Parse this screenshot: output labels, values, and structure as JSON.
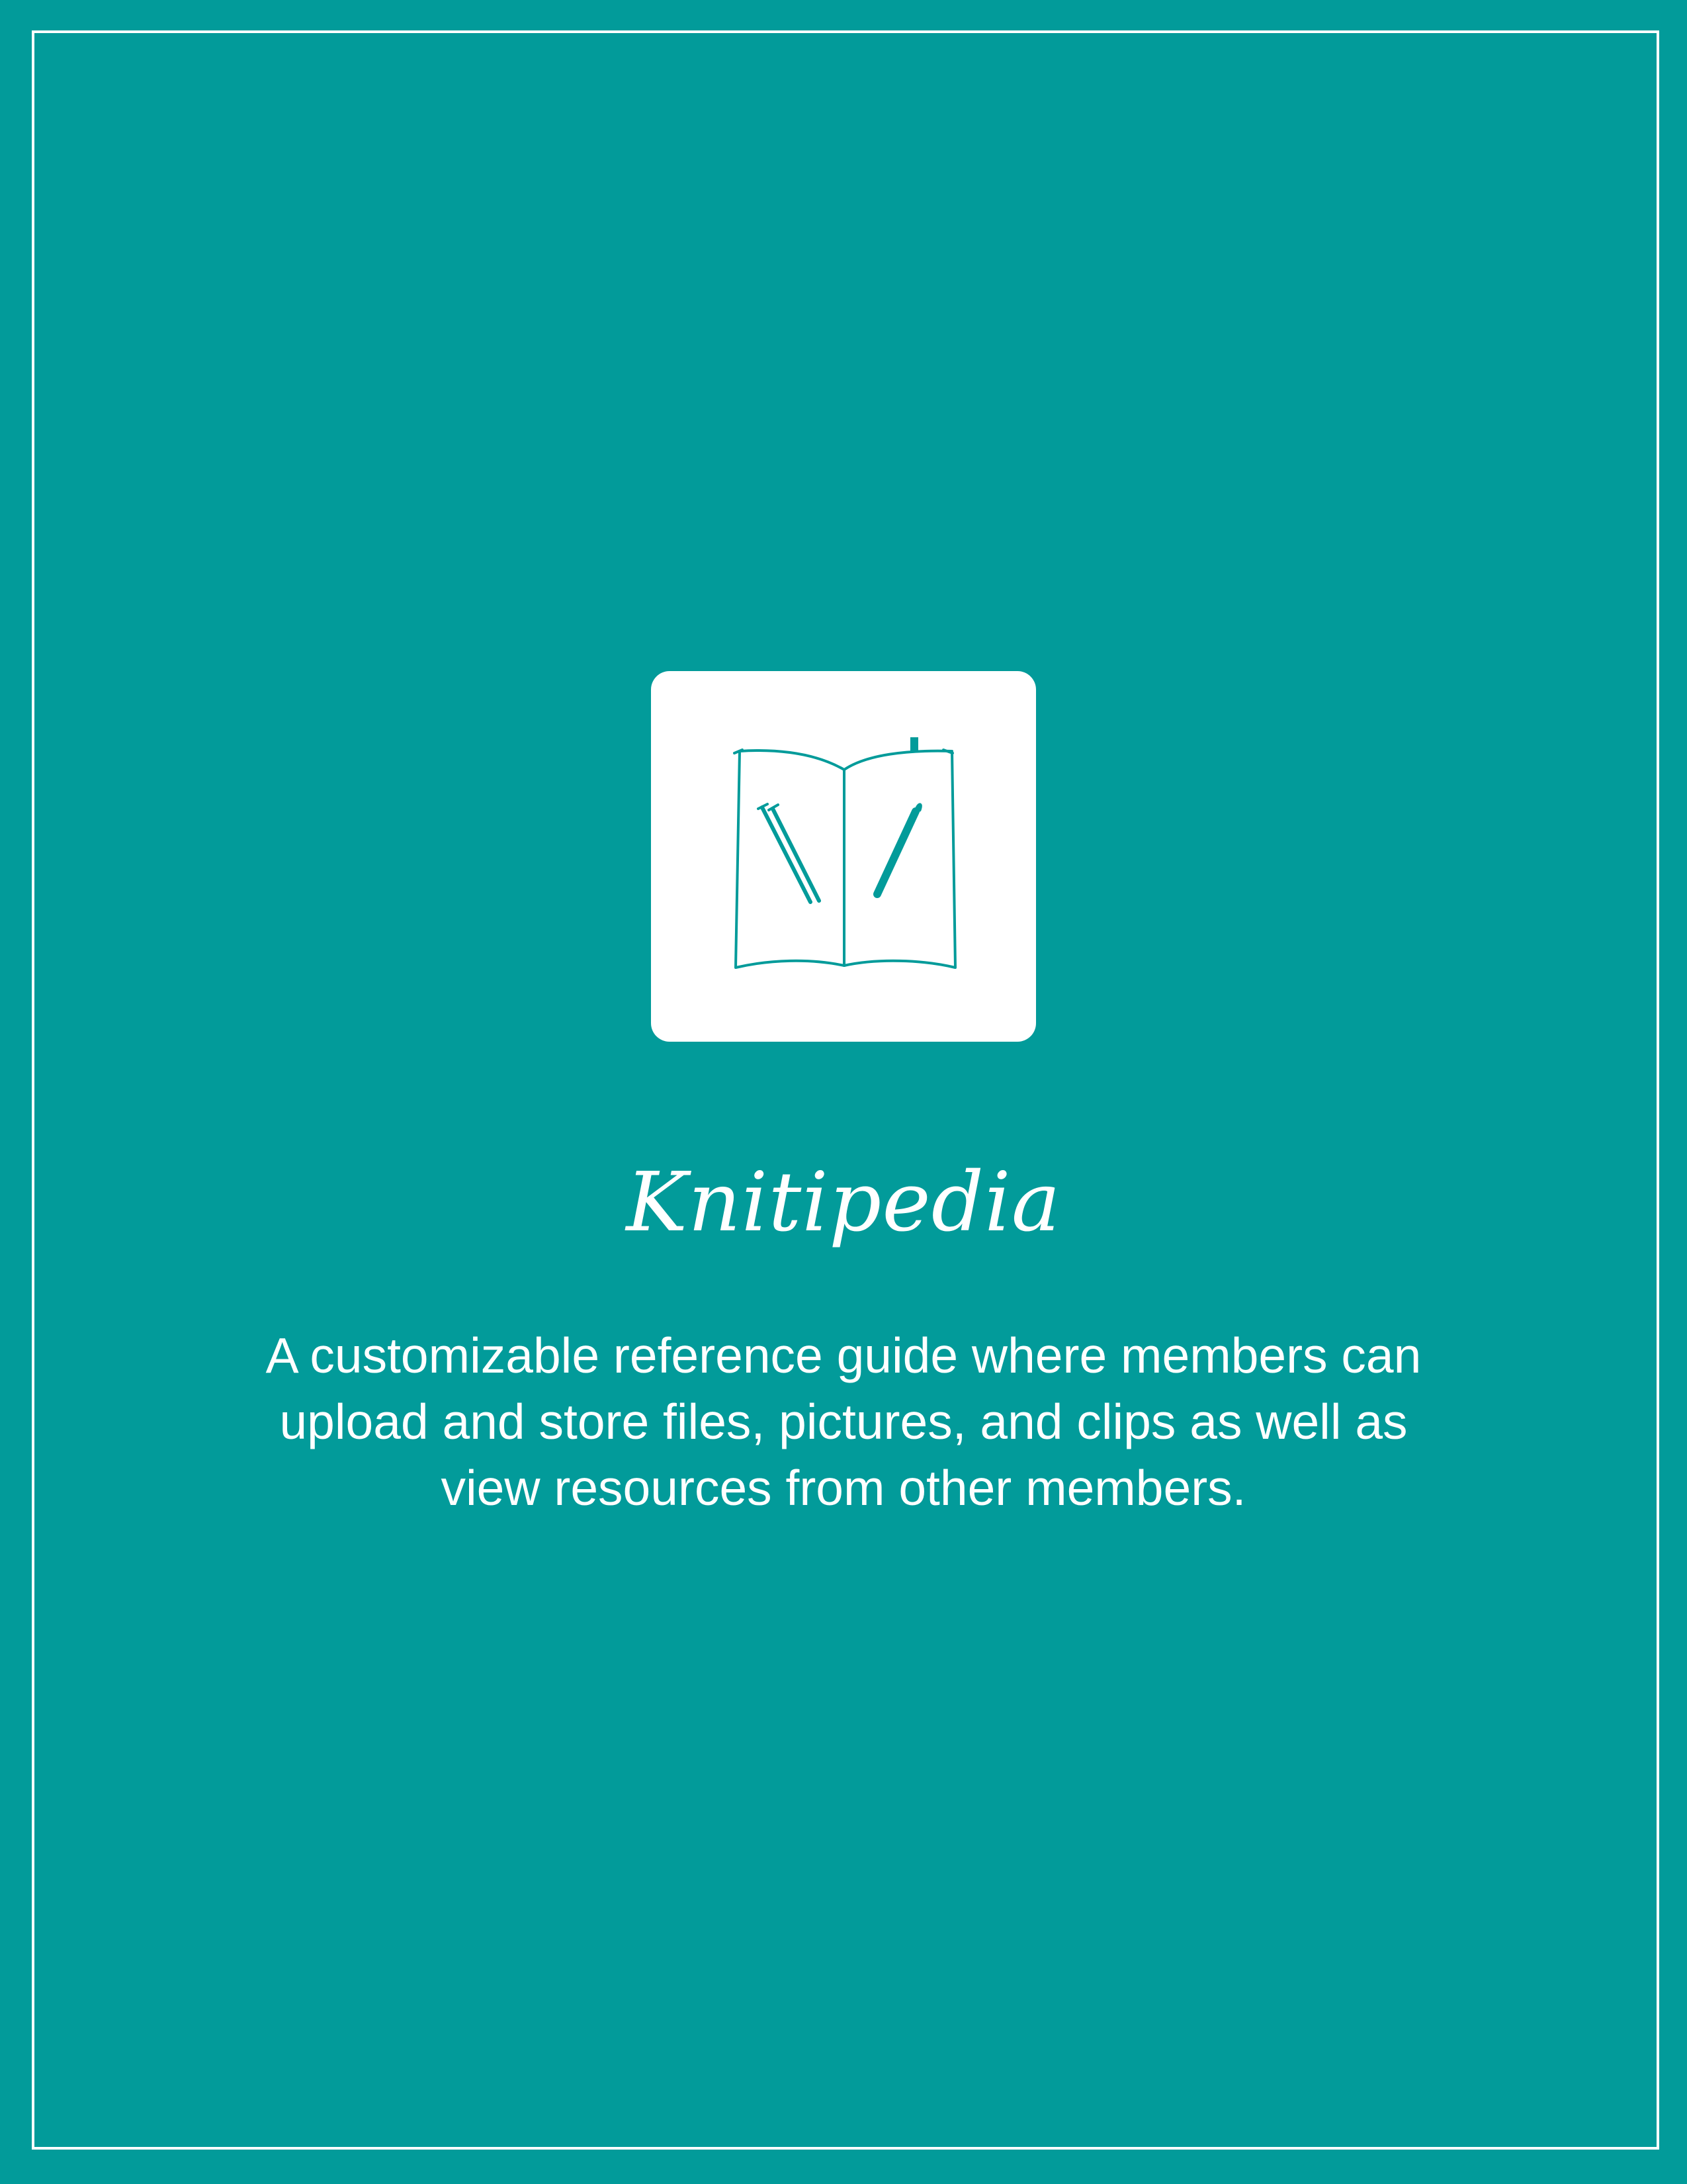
{
  "page": {
    "background_color": "#029b9a",
    "border_color": "#ffffff"
  },
  "logo": {
    "icon": "open-book-with-knitting-needles-icon",
    "tile_color": "#ffffff",
    "stroke_color": "#029b9a"
  },
  "title": "Knitipedia",
  "description": "A customizable reference guide where members can upload and store files, pictures, and clips as well as view resources from other members."
}
